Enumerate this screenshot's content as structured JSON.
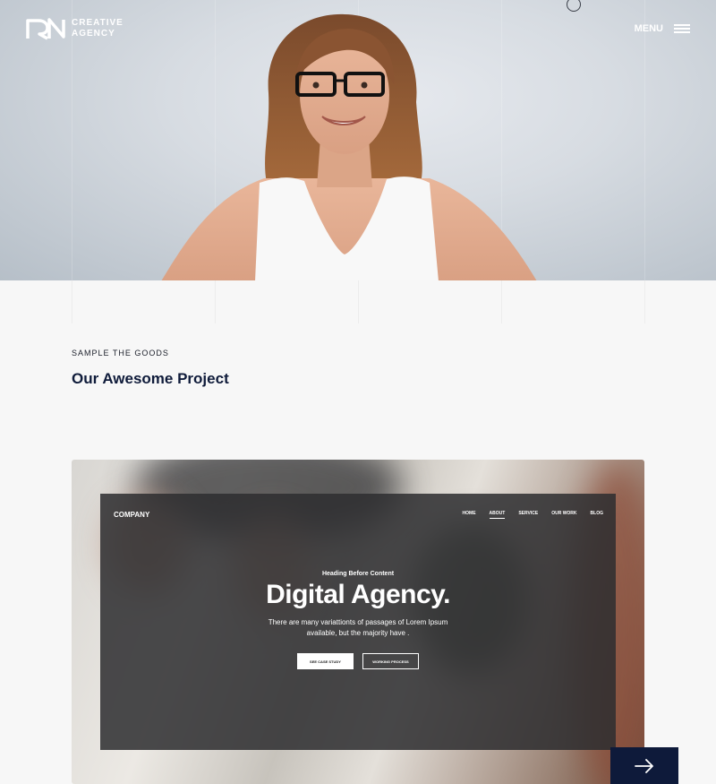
{
  "header": {
    "logo_line1": "CREATIVE",
    "logo_line2": "AGENCY",
    "menu_label": "MENU"
  },
  "section": {
    "eyebrow": "SAMPLE THE GOODS",
    "title": "Our Awesome Project"
  },
  "project_mockup": {
    "brand": "COMPANY",
    "nav": [
      {
        "label": "HOME",
        "active": false
      },
      {
        "label": "ABOUT",
        "active": true
      },
      {
        "label": "SERVICE",
        "active": false
      },
      {
        "label": "OUR WORK",
        "active": false
      },
      {
        "label": "BLOG",
        "active": false
      }
    ],
    "subheading": "Heading Before Content",
    "title": "Digital Agency.",
    "paragraph_line1": "There are many variattionts of passages of Lorem Ipsum",
    "paragraph_line2": "available, but the majority have .",
    "button_primary": "SEE CASE STUDY",
    "button_secondary": "WORKING PROCESS"
  },
  "icons": {
    "logo": "rn-logo-icon",
    "menu": "hamburger-icon",
    "next": "arrow-right-icon"
  },
  "colors": {
    "navy": "#0e1a3a",
    "title": "#0f1b3a"
  }
}
